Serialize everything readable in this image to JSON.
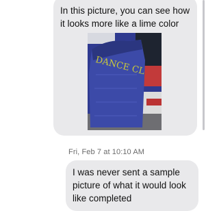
{
  "messages": [
    {
      "text": "In this picture, you can see how it looks more like a lime color",
      "attachment": {
        "kind": "photo",
        "jersey_text": "DANCE CL",
        "jersey_color": "#3c4aa8",
        "letter_color": "#c9c83a"
      }
    },
    {
      "text": "I was never sent a sample picture of what it would look like completed"
    }
  ],
  "timestamp": "Fri, Feb 7 at 10:10 AM",
  "colors": {
    "bubble_incoming": "#e9e9eb",
    "text": "#111111",
    "timestamp": "#6b6b6b"
  }
}
